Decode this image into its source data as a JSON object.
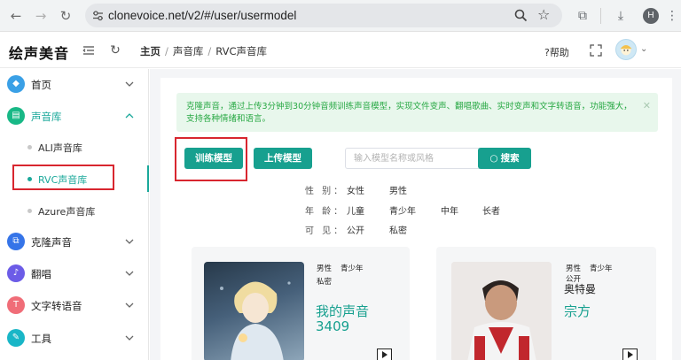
{
  "browser": {
    "url": "clonevoice.net/v2/#/user/usermodel",
    "profile_initial": "H"
  },
  "header": {
    "logo": "绘声美音",
    "breadcrumb": [
      "主页",
      "声音库",
      "RVC声音库"
    ],
    "help_label": "帮助"
  },
  "sidebar": {
    "items": [
      {
        "label": "首页",
        "icon": "diamond-icon",
        "color": "#3aa0e6"
      },
      {
        "label": "声音库",
        "icon": "music-library-icon",
        "color": "#18b886",
        "expanded": true,
        "children": [
          "ALI声音库",
          "RVC声音库",
          "Azure声音库"
        ]
      },
      {
        "label": "克隆声音",
        "icon": "clone-icon",
        "color": "#3574e8"
      },
      {
        "label": "翻唱",
        "icon": "sing-icon",
        "color": "#6c5ce7"
      },
      {
        "label": "文字转语音",
        "icon": "text-to-speech-icon",
        "color": "#f06d78"
      },
      {
        "label": "工具",
        "icon": "tool-icon",
        "color": "#19b6c7"
      }
    ]
  },
  "main": {
    "alert_text": "克隆声音，通过上传3分钟到30分钟音频训练声音模型，实现文件变声、翻唱歌曲、实时变声和文字转语音，功能强大，支持各种情绪和语言。",
    "train_button": "训练模型",
    "upload_button": "上传模型",
    "search_placeholder": "输入模型名称或风格",
    "search_button": "搜索",
    "filters": {
      "gender_label": "性 别：",
      "gender_options": [
        "女性",
        "男性"
      ],
      "age_label": "年 龄：",
      "age_options": [
        "儿童",
        "青少年",
        "中年",
        "长者"
      ],
      "visibility_label": "可 见：",
      "visibility_options": [
        "公开",
        "私密"
      ]
    },
    "cards": [
      {
        "tags": [
          "男性",
          "青少年"
        ],
        "visibility": "私密",
        "name": "我的声音",
        "id": "3409"
      },
      {
        "tags": [
          "男性",
          "青少年"
        ],
        "visibility": "公开",
        "subname": "奥特曼",
        "name": "宗方"
      }
    ]
  },
  "colors": {
    "accent": "#17a08f",
    "highlight_box": "#d8262f",
    "alert_bg": "#e8f7ec",
    "alert_text": "#27a843"
  }
}
